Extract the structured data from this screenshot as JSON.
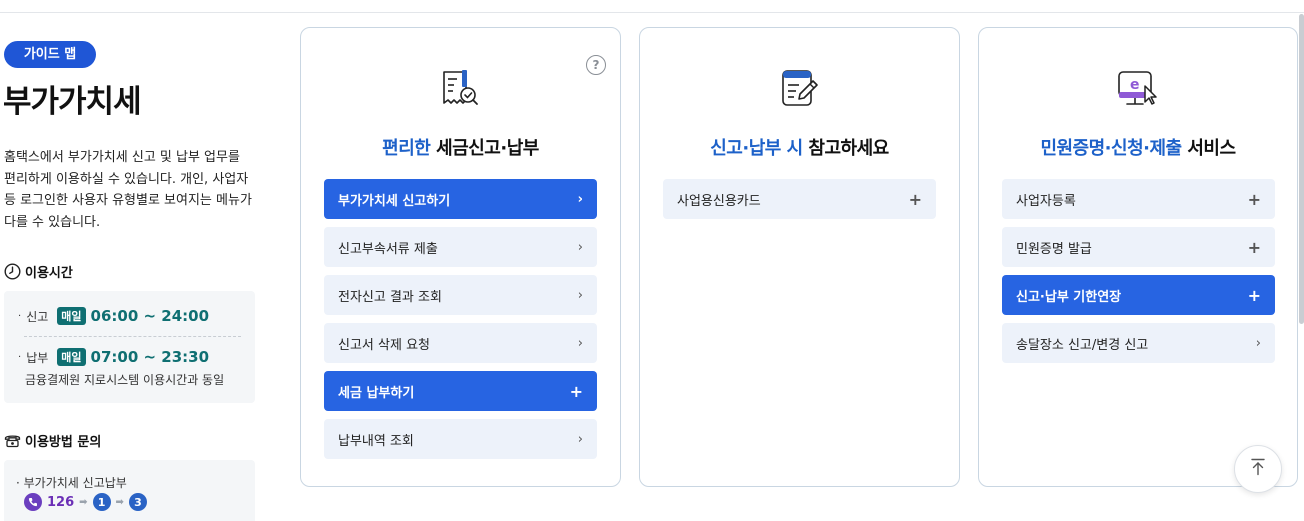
{
  "left": {
    "badge": "가이드 맵",
    "title": "부가가치세",
    "description": "홈택스에서 부가가치세 신고 및 납부 업무를 편리하게 이용하실 수 있습니다. 개인, 사업자 등 로그인한 사용자 유형별로 보여지는 메뉴가 다를 수 있습니다.",
    "hours": {
      "title": "이용시간",
      "rows": [
        {
          "label": "신고",
          "badge": "매일",
          "time": "06:00 ~ 24:00"
        },
        {
          "label": "납부",
          "badge": "매일",
          "time": "07:00 ~ 23:30"
        }
      ],
      "note": "금융결제원 지로시스템 이용시간과 동일"
    },
    "inquiry": {
      "title": "이용방법 문의",
      "label": "부가가치세 신고납부",
      "phone": "126",
      "step1": "1",
      "step2": "3"
    }
  },
  "cards": [
    {
      "title_highlight": "편리한",
      "title_rest": " 세금신고·납부",
      "help": "?",
      "items": [
        {
          "label": "부가가치세 신고하기",
          "active": true,
          "mark": "›"
        },
        {
          "label": "신고부속서류 제출",
          "active": false,
          "mark": "›"
        },
        {
          "label": "전자신고 결과 조회",
          "active": false,
          "mark": "›"
        },
        {
          "label": "신고서 삭제 요청",
          "active": false,
          "mark": "›"
        },
        {
          "label": "세금 납부하기",
          "active": true,
          "mark": "+"
        },
        {
          "label": "납부내역 조회",
          "active": false,
          "mark": "›"
        }
      ]
    },
    {
      "title_highlight": "신고·납부 시",
      "title_rest": " 참고하세요",
      "items": [
        {
          "label": "사업용신용카드",
          "active": false,
          "mark": "+"
        }
      ]
    },
    {
      "title_highlight": "민원증명·신청·제출",
      "title_rest": " 서비스",
      "items": [
        {
          "label": "사업자등록",
          "active": false,
          "mark": "+"
        },
        {
          "label": "민원증명 발급",
          "active": false,
          "mark": "+"
        },
        {
          "label": "신고·납부 기한연장",
          "active": true,
          "mark": "+"
        },
        {
          "label": "송달장소 신고/변경 신고",
          "active": false,
          "mark": "›"
        }
      ]
    }
  ],
  "icons": {
    "card1": "tax-document-check-icon",
    "card2": "note-pen-icon",
    "card3": "e-monitor-cursor-icon",
    "clock": "clock-icon",
    "phone": "phone-icon",
    "scroll": "arrow-up-to-top-icon"
  },
  "colors": {
    "primary": "#2764e2",
    "highlight": "#1d61c9",
    "teal": "#0f6f72",
    "item_bg": "#edf2fa"
  }
}
